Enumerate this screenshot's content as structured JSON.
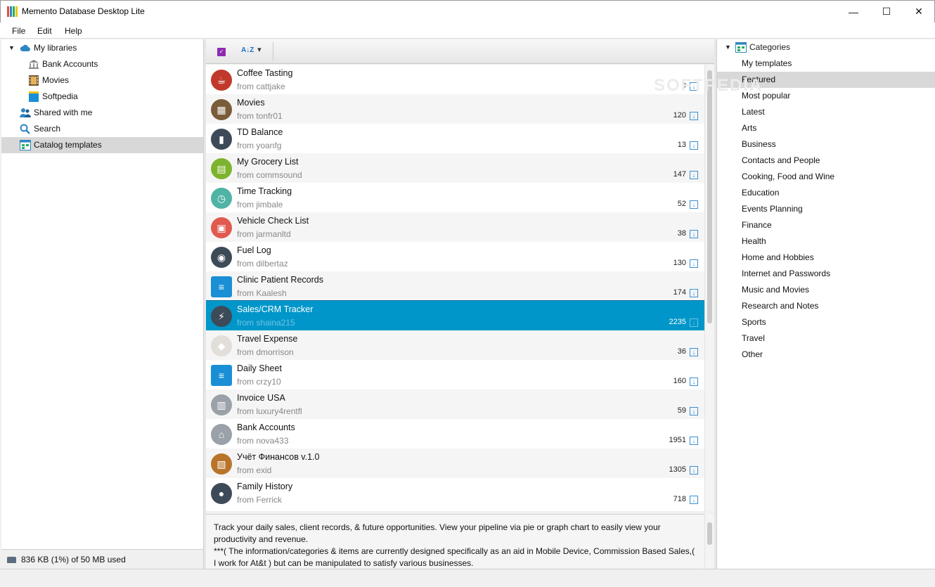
{
  "window": {
    "title": "Memento Database Desktop Lite",
    "minimize": "—",
    "maximize": "☐",
    "close": "✕"
  },
  "menu": [
    "File",
    "Edit",
    "Help"
  ],
  "left": {
    "tree": [
      {
        "label": "My libraries",
        "icon": "cloud-icon"
      },
      {
        "label": "Bank Accounts",
        "icon": "bank-icon"
      },
      {
        "label": "Movies",
        "icon": "film-icon"
      },
      {
        "label": "Softpedia",
        "icon": "book-icon"
      },
      {
        "label": "Shared with me",
        "icon": "users-icon"
      },
      {
        "label": "Search",
        "icon": "search-icon"
      },
      {
        "label": "Catalog templates",
        "icon": "catalog-icon"
      }
    ],
    "storage": "836 KB (1%) of 50 MB used"
  },
  "toolbar": {
    "sort_label": "A↓Z",
    "sort_arrow": "▾",
    "check": "✓"
  },
  "templates": [
    {
      "title": "Coffee Tasting",
      "author": "from cattjake",
      "count": "9",
      "icon": "coffee-icon",
      "color": "#c0392b",
      "glyph": "☕"
    },
    {
      "title": "Movies",
      "author": "from tonfr01",
      "count": "120",
      "icon": "film-icon",
      "color": "#7a5c3a",
      "glyph": "▦"
    },
    {
      "title": "TD Balance",
      "author": "from yoanfg",
      "count": "13",
      "icon": "chart-icon",
      "color": "#3d4a57",
      "glyph": "▮"
    },
    {
      "title": "My Grocery List",
      "author": "from commsound",
      "count": "147",
      "icon": "basket-icon",
      "color": "#7db32e",
      "glyph": "▤"
    },
    {
      "title": "Time Tracking",
      "author": "from jimbale",
      "count": "52",
      "icon": "clock-icon",
      "color": "#4fb3a5",
      "glyph": "◷"
    },
    {
      "title": "Vehicle Check List",
      "author": "from jarmanltd",
      "count": "38",
      "icon": "vehicle-icon",
      "color": "#e05a4f",
      "glyph": "▣"
    },
    {
      "title": "Fuel Log",
      "author": "from dilbertaz",
      "count": "130",
      "icon": "car-icon",
      "color": "#3d4a57",
      "glyph": "◉"
    },
    {
      "title": "Clinic Patient Records",
      "author": "from Kaalesh",
      "count": "174",
      "icon": "folder-icon",
      "color": "#1a8fd6",
      "glyph": "≡"
    },
    {
      "title": "Sales/CRM Tracker",
      "author": "from shaina215",
      "count": "2235",
      "icon": "bolt-icon",
      "color": "#3d4a57",
      "glyph": "⚡"
    },
    {
      "title": "Travel Expense",
      "author": "from dmorrison",
      "count": "36",
      "icon": "car-icon",
      "color": "#e2ded9",
      "glyph": "◆"
    },
    {
      "title": "Daily Sheet",
      "author": "from crzy10",
      "count": "160",
      "icon": "folder-icon",
      "color": "#1a8fd6",
      "glyph": "≡"
    },
    {
      "title": "Invoice USA",
      "author": "from luxury4rentfl",
      "count": "59",
      "icon": "printer-icon",
      "color": "#9aa1a8",
      "glyph": "▥"
    },
    {
      "title": "Bank Accounts",
      "author": "from nova433",
      "count": "1951",
      "icon": "bank-icon",
      "color": "#9aa1a8",
      "glyph": "⌂"
    },
    {
      "title": "Учёт Финансов v.1.0",
      "author": "from exid",
      "count": "1305",
      "icon": "wallet-icon",
      "color": "#b8742a",
      "glyph": "▧"
    },
    {
      "title": "Family History",
      "author": "from Ferrick",
      "count": "718",
      "icon": "person-icon",
      "color": "#3d4a57",
      "glyph": "●"
    }
  ],
  "description": {
    "line1": "Track your daily sales, client records, & future opportunities. View your pipeline via pie or graph chart to easily view your productivity and revenue.",
    "line2": "***( The information/categories   & items are currently designed specifically as an aid in Mobile Device, Commission Based Sales,( I work for At&t ) but can be manipulated to satisfy various businesses."
  },
  "categories": {
    "root": "Categories",
    "items": [
      "My templates",
      "Featured",
      "Most popular",
      "Latest",
      "Arts",
      "Business",
      "Contacts and People",
      "Cooking, Food and Wine",
      "Education",
      "Events Planning",
      "Finance",
      "Health",
      "Home and Hobbies",
      "Internet and Passwords",
      "Music and Movies",
      "Research and Notes",
      "Sports",
      "Travel",
      "Other"
    ]
  },
  "download_glyph": "↓",
  "colors": {
    "selection": "#0096c9",
    "accent": "#1d6fc2"
  }
}
